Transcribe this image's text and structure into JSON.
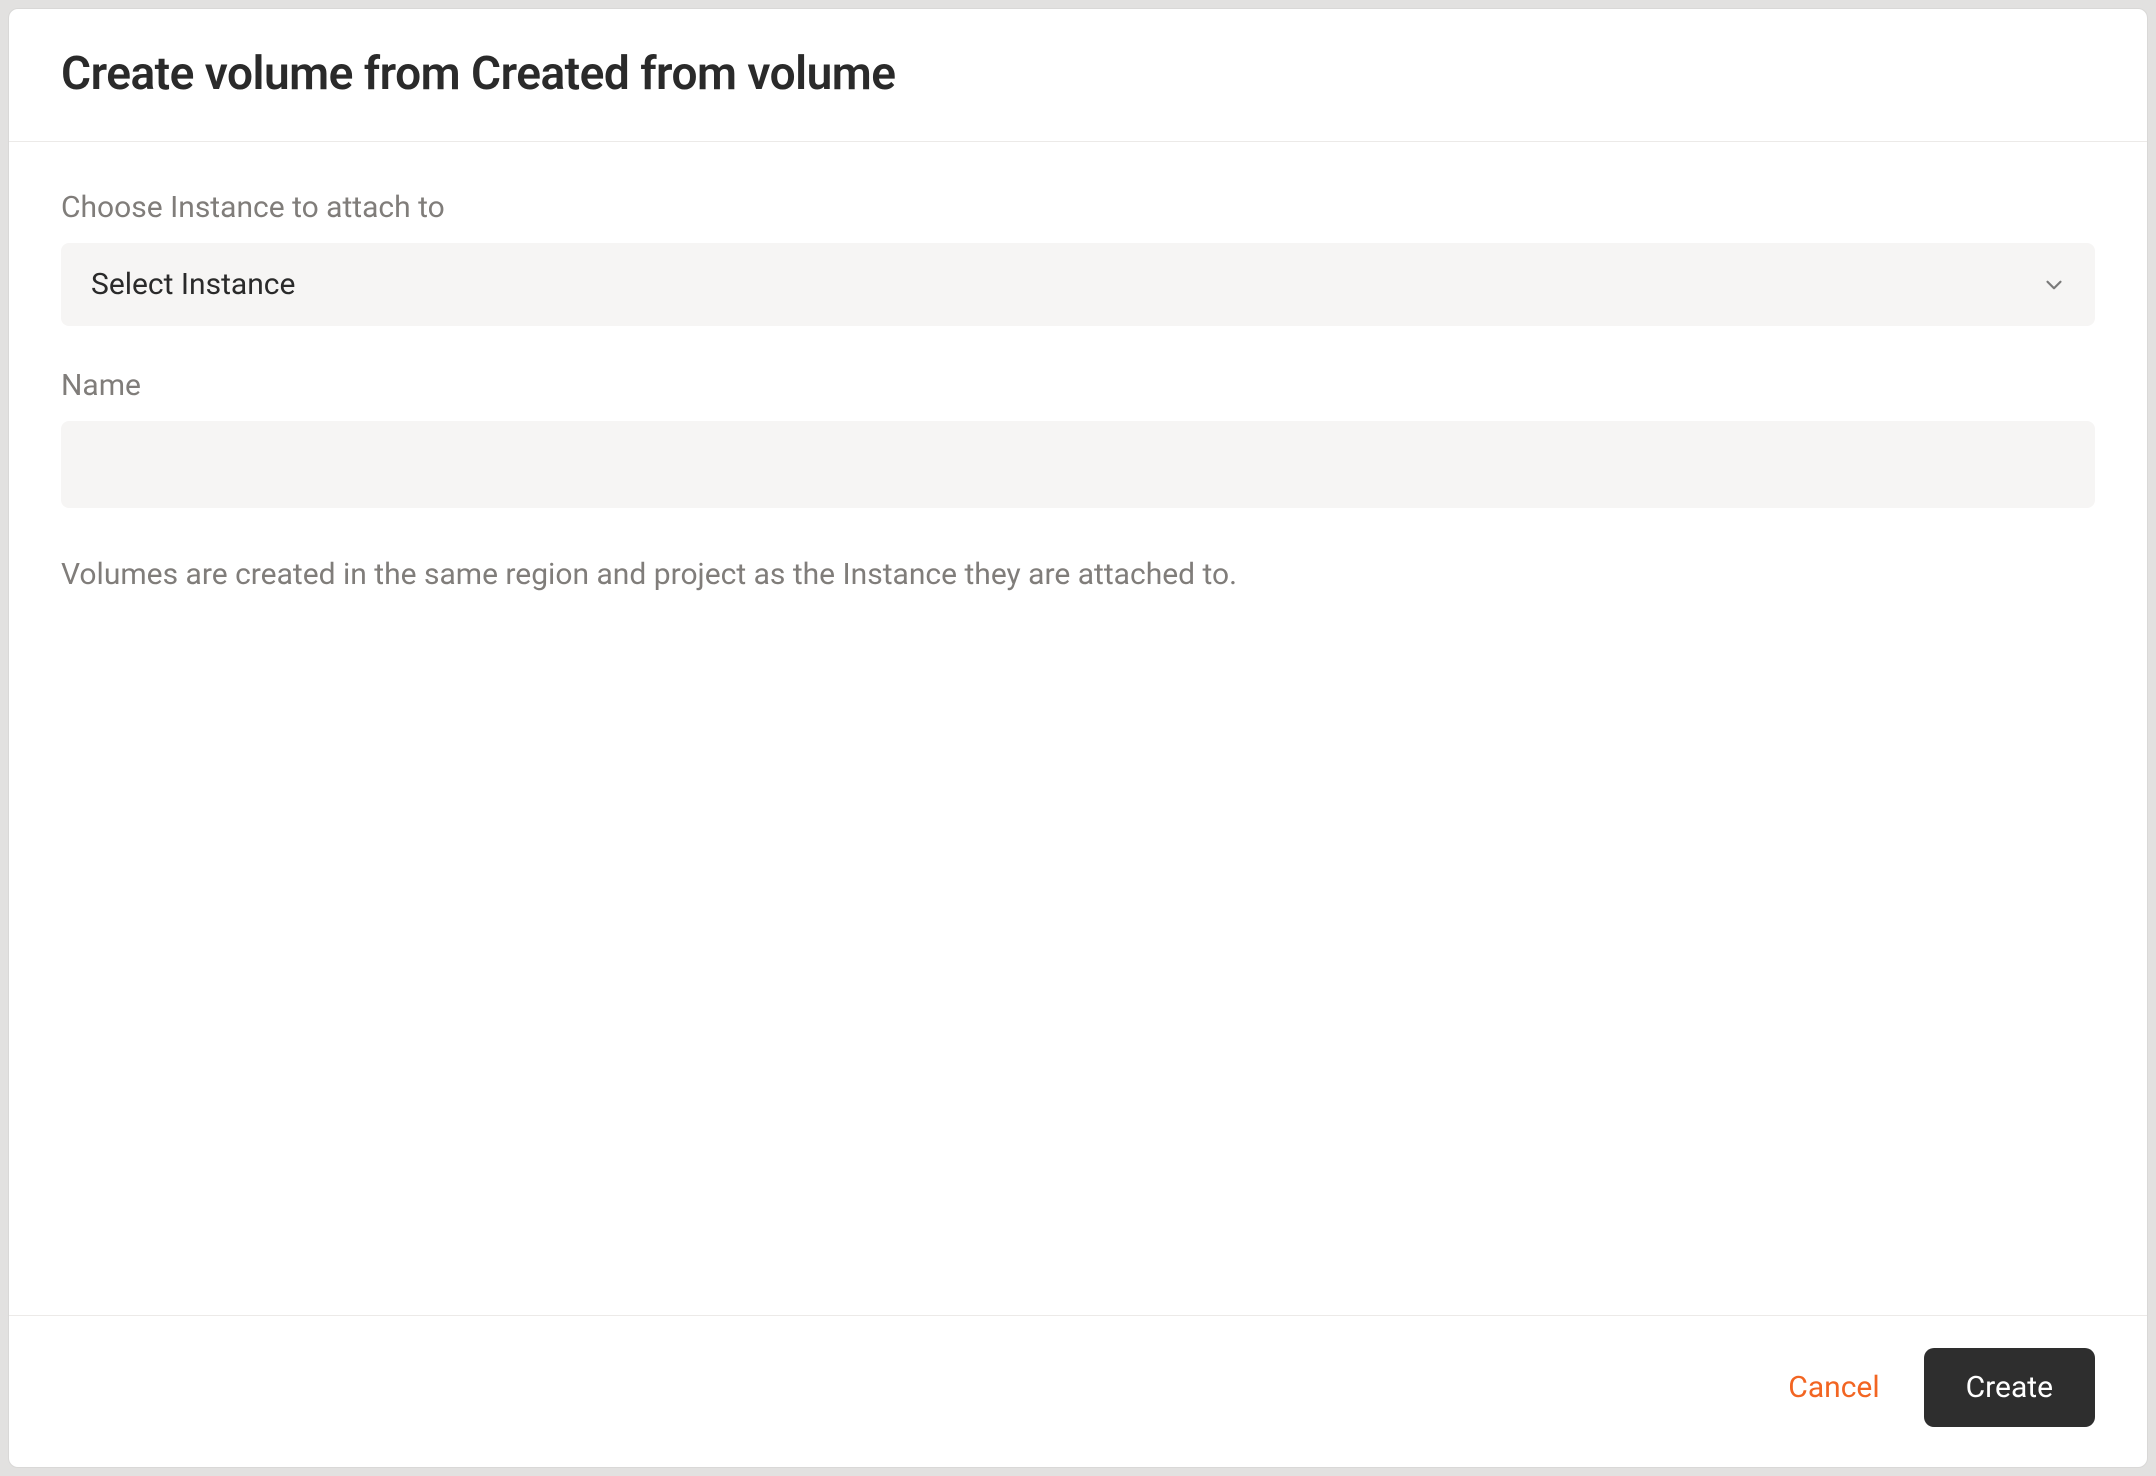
{
  "modal": {
    "title": "Create volume from Created from volume",
    "instance_label": "Choose Instance to attach to",
    "instance_placeholder": "Select Instance",
    "name_label": "Name",
    "name_value": "",
    "help_text": "Volumes are created in the same region and project as the Instance they are attached to.",
    "cancel_label": "Cancel",
    "create_label": "Create"
  },
  "colors": {
    "accent": "#f26522",
    "primary_button_bg": "#2e2e2e",
    "field_bg": "#f6f5f4",
    "text_muted": "#807d7a"
  }
}
